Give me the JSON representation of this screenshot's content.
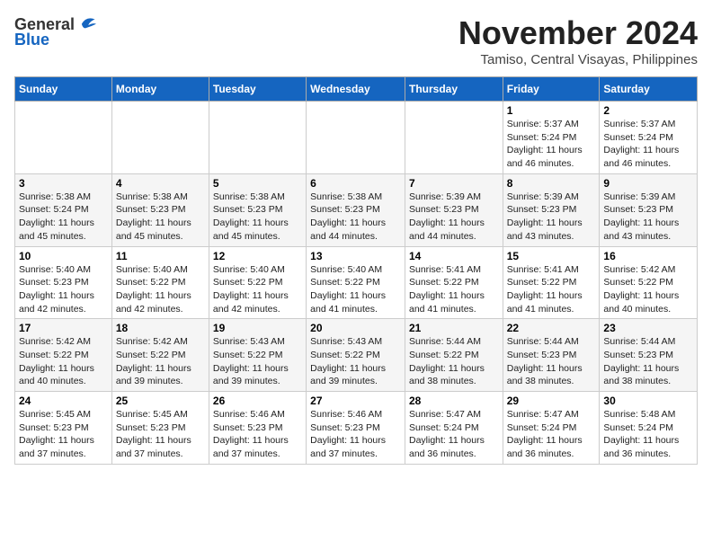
{
  "logo": {
    "line1": "General",
    "line2": "Blue"
  },
  "title": "November 2024",
  "location": "Tamiso, Central Visayas, Philippines",
  "days_of_week": [
    "Sunday",
    "Monday",
    "Tuesday",
    "Wednesday",
    "Thursday",
    "Friday",
    "Saturday"
  ],
  "weeks": [
    [
      {
        "day": "",
        "info": ""
      },
      {
        "day": "",
        "info": ""
      },
      {
        "day": "",
        "info": ""
      },
      {
        "day": "",
        "info": ""
      },
      {
        "day": "",
        "info": ""
      },
      {
        "day": "1",
        "info": "Sunrise: 5:37 AM\nSunset: 5:24 PM\nDaylight: 11 hours and 46 minutes."
      },
      {
        "day": "2",
        "info": "Sunrise: 5:37 AM\nSunset: 5:24 PM\nDaylight: 11 hours and 46 minutes."
      }
    ],
    [
      {
        "day": "3",
        "info": "Sunrise: 5:38 AM\nSunset: 5:24 PM\nDaylight: 11 hours and 45 minutes."
      },
      {
        "day": "4",
        "info": "Sunrise: 5:38 AM\nSunset: 5:23 PM\nDaylight: 11 hours and 45 minutes."
      },
      {
        "day": "5",
        "info": "Sunrise: 5:38 AM\nSunset: 5:23 PM\nDaylight: 11 hours and 45 minutes."
      },
      {
        "day": "6",
        "info": "Sunrise: 5:38 AM\nSunset: 5:23 PM\nDaylight: 11 hours and 44 minutes."
      },
      {
        "day": "7",
        "info": "Sunrise: 5:39 AM\nSunset: 5:23 PM\nDaylight: 11 hours and 44 minutes."
      },
      {
        "day": "8",
        "info": "Sunrise: 5:39 AM\nSunset: 5:23 PM\nDaylight: 11 hours and 43 minutes."
      },
      {
        "day": "9",
        "info": "Sunrise: 5:39 AM\nSunset: 5:23 PM\nDaylight: 11 hours and 43 minutes."
      }
    ],
    [
      {
        "day": "10",
        "info": "Sunrise: 5:40 AM\nSunset: 5:23 PM\nDaylight: 11 hours and 42 minutes."
      },
      {
        "day": "11",
        "info": "Sunrise: 5:40 AM\nSunset: 5:22 PM\nDaylight: 11 hours and 42 minutes."
      },
      {
        "day": "12",
        "info": "Sunrise: 5:40 AM\nSunset: 5:22 PM\nDaylight: 11 hours and 42 minutes."
      },
      {
        "day": "13",
        "info": "Sunrise: 5:40 AM\nSunset: 5:22 PM\nDaylight: 11 hours and 41 minutes."
      },
      {
        "day": "14",
        "info": "Sunrise: 5:41 AM\nSunset: 5:22 PM\nDaylight: 11 hours and 41 minutes."
      },
      {
        "day": "15",
        "info": "Sunrise: 5:41 AM\nSunset: 5:22 PM\nDaylight: 11 hours and 41 minutes."
      },
      {
        "day": "16",
        "info": "Sunrise: 5:42 AM\nSunset: 5:22 PM\nDaylight: 11 hours and 40 minutes."
      }
    ],
    [
      {
        "day": "17",
        "info": "Sunrise: 5:42 AM\nSunset: 5:22 PM\nDaylight: 11 hours and 40 minutes."
      },
      {
        "day": "18",
        "info": "Sunrise: 5:42 AM\nSunset: 5:22 PM\nDaylight: 11 hours and 39 minutes."
      },
      {
        "day": "19",
        "info": "Sunrise: 5:43 AM\nSunset: 5:22 PM\nDaylight: 11 hours and 39 minutes."
      },
      {
        "day": "20",
        "info": "Sunrise: 5:43 AM\nSunset: 5:22 PM\nDaylight: 11 hours and 39 minutes."
      },
      {
        "day": "21",
        "info": "Sunrise: 5:44 AM\nSunset: 5:22 PM\nDaylight: 11 hours and 38 minutes."
      },
      {
        "day": "22",
        "info": "Sunrise: 5:44 AM\nSunset: 5:23 PM\nDaylight: 11 hours and 38 minutes."
      },
      {
        "day": "23",
        "info": "Sunrise: 5:44 AM\nSunset: 5:23 PM\nDaylight: 11 hours and 38 minutes."
      }
    ],
    [
      {
        "day": "24",
        "info": "Sunrise: 5:45 AM\nSunset: 5:23 PM\nDaylight: 11 hours and 37 minutes."
      },
      {
        "day": "25",
        "info": "Sunrise: 5:45 AM\nSunset: 5:23 PM\nDaylight: 11 hours and 37 minutes."
      },
      {
        "day": "26",
        "info": "Sunrise: 5:46 AM\nSunset: 5:23 PM\nDaylight: 11 hours and 37 minutes."
      },
      {
        "day": "27",
        "info": "Sunrise: 5:46 AM\nSunset: 5:23 PM\nDaylight: 11 hours and 37 minutes."
      },
      {
        "day": "28",
        "info": "Sunrise: 5:47 AM\nSunset: 5:24 PM\nDaylight: 11 hours and 36 minutes."
      },
      {
        "day": "29",
        "info": "Sunrise: 5:47 AM\nSunset: 5:24 PM\nDaylight: 11 hours and 36 minutes."
      },
      {
        "day": "30",
        "info": "Sunrise: 5:48 AM\nSunset: 5:24 PM\nDaylight: 11 hours and 36 minutes."
      }
    ]
  ]
}
